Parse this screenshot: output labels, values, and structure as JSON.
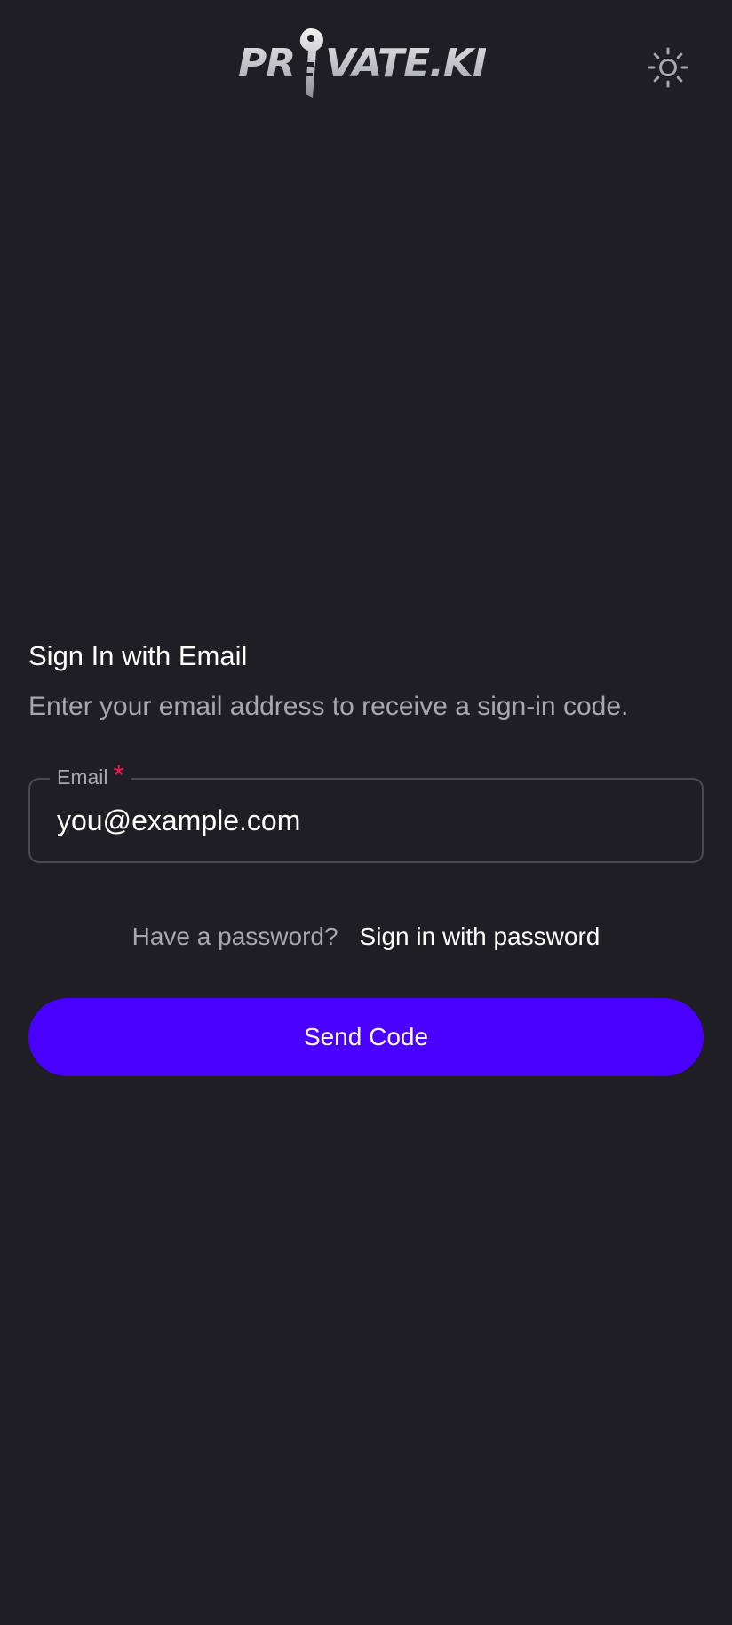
{
  "header": {
    "logo_text_left": "PR",
    "logo_text_right": "VATE.KI",
    "logo_icon": "key-icon",
    "theme_toggle_icon": "sun-icon"
  },
  "signin": {
    "title": "Sign In with Email",
    "subtitle": "Enter your email address to receive a sign-in code.",
    "email_label": "Email",
    "email_required_mark": "*",
    "email_placeholder": "you@example.com",
    "password_prompt": "Have a password?",
    "password_link": "Sign in with password",
    "submit_label": "Send Code"
  },
  "colors": {
    "background": "#1f1e24",
    "accent": "#4a00ff",
    "required": "#f0184e",
    "muted_text": "#a8a7ad",
    "border": "#4a4950"
  }
}
